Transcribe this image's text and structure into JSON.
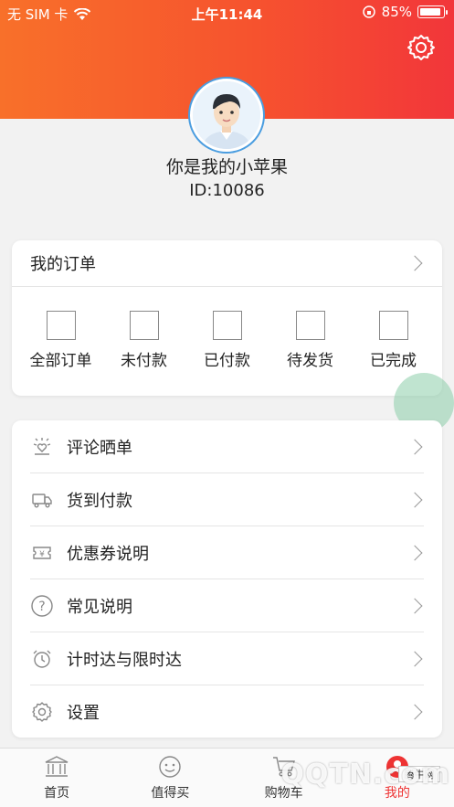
{
  "status_bar": {
    "carrier": "无 SIM 卡",
    "time": "上午11:44",
    "battery": "85%"
  },
  "profile": {
    "username": "你是我的小苹果",
    "id": "ID:10086"
  },
  "orders": {
    "title": "我的订单",
    "items": [
      {
        "label": "全部订单"
      },
      {
        "label": "未付款"
      },
      {
        "label": "已付款"
      },
      {
        "label": "待发货"
      },
      {
        "label": "已完成"
      }
    ]
  },
  "menu": {
    "items": [
      {
        "label": "评论晒单",
        "icon": "sun-heart-icon"
      },
      {
        "label": "货到付款",
        "icon": "truck-icon"
      },
      {
        "label": "优惠券说明",
        "icon": "coupon-icon"
      },
      {
        "label": "常见说明",
        "icon": "question-icon"
      },
      {
        "label": "计时达与限时达",
        "icon": "alarm-icon"
      },
      {
        "label": "设置",
        "icon": "gear-icon"
      }
    ]
  },
  "tabbar": {
    "items": [
      {
        "label": "首页",
        "icon": "bank-icon"
      },
      {
        "label": "值得买",
        "icon": "face-icon"
      },
      {
        "label": "购物车",
        "icon": "cart-icon"
      },
      {
        "label": "我的",
        "icon": "user-icon"
      }
    ]
  },
  "watermark": {
    "text": "QQTN.com",
    "badge": "腾牛网"
  },
  "colors": {
    "header_start": "#f8702a",
    "header_end": "#f2363a",
    "accent": "#e33333"
  }
}
